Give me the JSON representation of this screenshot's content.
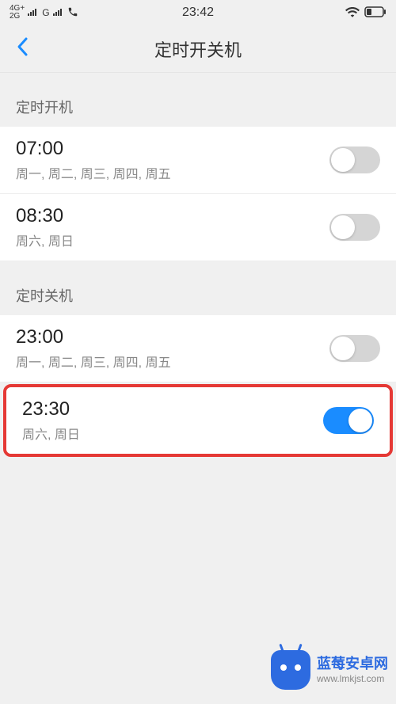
{
  "statusBar": {
    "network1": "4G+",
    "network2": "2G",
    "network3": "G",
    "time": "23:42"
  },
  "header": {
    "title": "定时开关机"
  },
  "sections": {
    "powerOn": {
      "label": "定时开机",
      "items": [
        {
          "time": "07:00",
          "days": "周一, 周二, 周三, 周四, 周五",
          "enabled": false
        },
        {
          "time": "08:30",
          "days": "周六, 周日",
          "enabled": false
        }
      ]
    },
    "powerOff": {
      "label": "定时关机",
      "items": [
        {
          "time": "23:00",
          "days": "周一, 周二, 周三, 周四, 周五",
          "enabled": false
        },
        {
          "time": "23:30",
          "days": "周六, 周日",
          "enabled": true,
          "highlighted": true
        }
      ]
    }
  },
  "watermark": {
    "title": "蓝莓安卓网",
    "url": "www.lmkjst.com"
  }
}
